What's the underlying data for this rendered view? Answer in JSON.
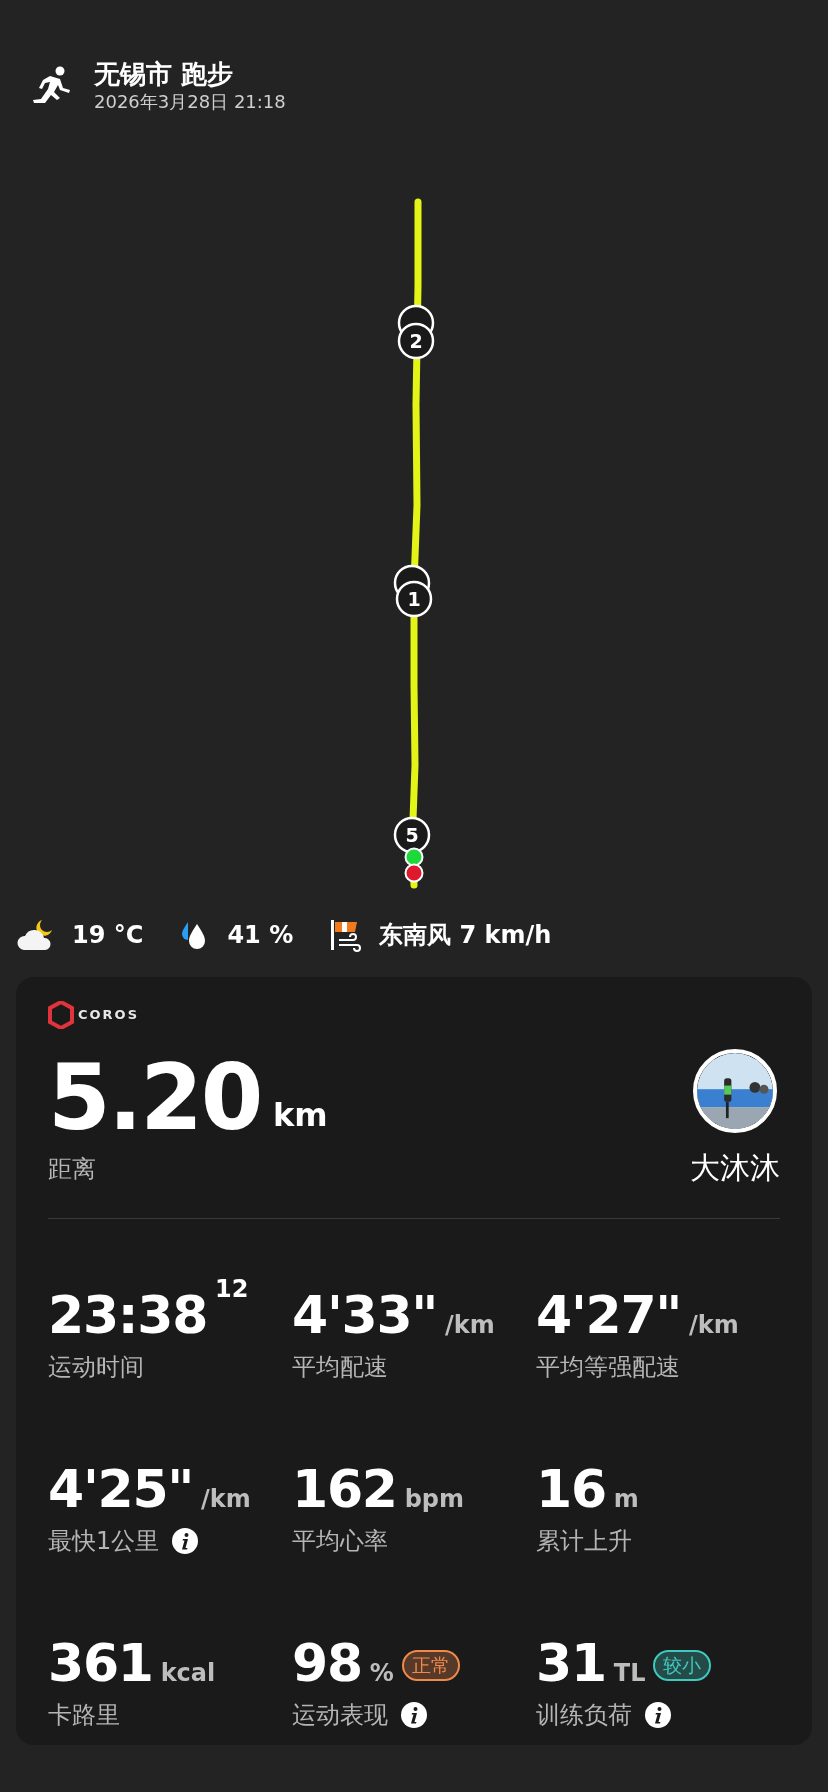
{
  "header": {
    "title": "无锡市 跑步",
    "datetime": "2026年3月28日 21:18"
  },
  "map": {
    "markers": [
      "2",
      "1",
      "5"
    ]
  },
  "weather": {
    "temperature": "19 °C",
    "humidity": "41 %",
    "wind": "东南风 7 km/h"
  },
  "card": {
    "brand": "COROS",
    "distance": {
      "value": "5.20",
      "unit": "km",
      "label": "距离"
    },
    "user": {
      "name": "大沐沐"
    },
    "stats": [
      {
        "value": "23:38",
        "unit": "12",
        "kind": "sup",
        "label": "运动时间",
        "info": false
      },
      {
        "value": "4'33\"",
        "unit": "/km",
        "kind": "unit",
        "label": "平均配速",
        "info": false
      },
      {
        "value": "4'27\"",
        "unit": "/km",
        "kind": "unit",
        "label": "平均等强配速",
        "info": false
      },
      {
        "value": "4'25\"",
        "unit": "/km",
        "kind": "unit",
        "label": "最快1公里",
        "info": true
      },
      {
        "value": "162",
        "unit": "bpm",
        "kind": "unit",
        "label": "平均心率",
        "info": false
      },
      {
        "value": "16",
        "unit": "m",
        "kind": "unit",
        "label": "累计上升",
        "info": false
      },
      {
        "value": "361",
        "unit": "kcal",
        "kind": "unit",
        "label": "卡路里",
        "info": false
      },
      {
        "value": "98",
        "unit": "%",
        "kind": "unit",
        "label": "运动表现",
        "info": true,
        "badge": {
          "text": "正常",
          "color": "#f08a4b"
        }
      },
      {
        "value": "31",
        "unit": "TL",
        "kind": "unit",
        "label": "训练负荷",
        "info": true,
        "badge": {
          "text": "较小",
          "color": "#3fc9c0"
        }
      }
    ]
  }
}
